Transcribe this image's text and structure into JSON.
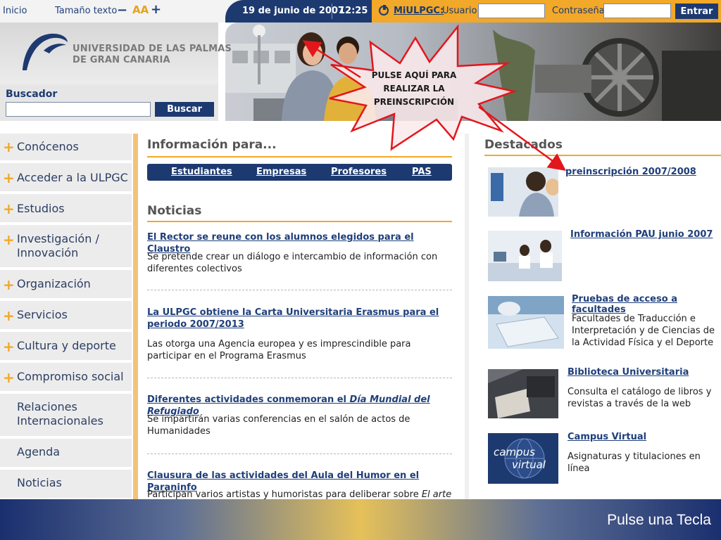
{
  "topbar": {
    "inicio": "Inicio",
    "tamano_label": "Tamaño texto",
    "minus": "−",
    "aa": "AA",
    "plus": "+",
    "fecha": "19 de junio de 2007",
    "hora": "12:25",
    "miulpgc": "MiULPGC:",
    "usuario_label": "Usuario",
    "usuario_value": "",
    "contrasena_label": "Contraseña",
    "contrasena_value": "",
    "entrar": "Entrar"
  },
  "header": {
    "univ_line1": "UNIVERSIDAD DE LAS PALMAS",
    "univ_line2": "DE GRAN CANARIA",
    "buscador_label": "Buscador",
    "buscar_value": "",
    "buscar_button": "Buscar"
  },
  "callout": {
    "text": "PULSE AQUÍ PARA REALIZAR LA PREINSCRIPCIÓN",
    "color": "#e3161c"
  },
  "menu": {
    "items": [
      {
        "label": "Conócenos",
        "plus": "+"
      },
      {
        "label": "Acceder a la ULPGC",
        "plus": "+"
      },
      {
        "label": "Estudios",
        "plus": "+"
      },
      {
        "label": "Investigación / Innovación",
        "plus": "+"
      },
      {
        "label": "Organización",
        "plus": "+"
      },
      {
        "label": "Servicios",
        "plus": "+"
      },
      {
        "label": "Cultura y deporte",
        "plus": "+"
      },
      {
        "label": "Compromiso social",
        "plus": "+"
      },
      {
        "label": "Relaciones Internacionales",
        "plus": ""
      },
      {
        "label": "Agenda",
        "plus": ""
      },
      {
        "label": "Noticias",
        "plus": ""
      }
    ]
  },
  "info": {
    "title": "Información para...",
    "links": [
      "Estudiantes",
      "Empresas",
      "Profesores",
      "PAS"
    ]
  },
  "noticias": {
    "title": "Noticias",
    "items": [
      {
        "title": "El Rector se reune con los alumnos elegidos para el Claustro",
        "text": "Se pretende crear un diálogo e intercambio de información con diferentes colectivos"
      },
      {
        "title": "La ULPGC obtiene la Carta Universitaria Erasmus para el periodo 2007/2013",
        "text": "Las otorga una Agencia europea y es imprescindible para participar en el Programa Erasmus"
      },
      {
        "title_plain": "Diferentes actividades conmemoran el ",
        "title_italic": "Día Mundial del Refugiado",
        "text": "Se impartirán varias conferencias en el salón de actos de Humanidades"
      },
      {
        "title": "Clausura de las actividades del Aula del Humor en el Paraninfo",
        "text_plain": "Participan varios artistas y humoristas para deliberar sobre ",
        "text_italic": "El arte en"
      }
    ]
  },
  "destacados": {
    "title": "Destacados",
    "items": [
      {
        "title": "preinscripción 2007/2008",
        "text": ""
      },
      {
        "title": "Información PAU junio 2007",
        "text": ""
      },
      {
        "title": "Pruebas de acceso a facultades",
        "text": "Facultades de Traducción e Interpretación y de Ciencias de la Actividad Física y el Deporte"
      },
      {
        "title": "Biblioteca Universitaria",
        "text": "Consulta el catálogo de libros y revistas a través de la web"
      },
      {
        "title": "Campus Virtual",
        "text": "Asignaturas y titulaciones en línea",
        "thumb_text_1": "campus",
        "thumb_text_2": "virtual"
      }
    ]
  },
  "footer": {
    "pulse": "Pulse una Tecla"
  },
  "colors": {
    "navy": "#1d3a70",
    "orange": "#f2a828",
    "link": "#1f3f7a"
  }
}
